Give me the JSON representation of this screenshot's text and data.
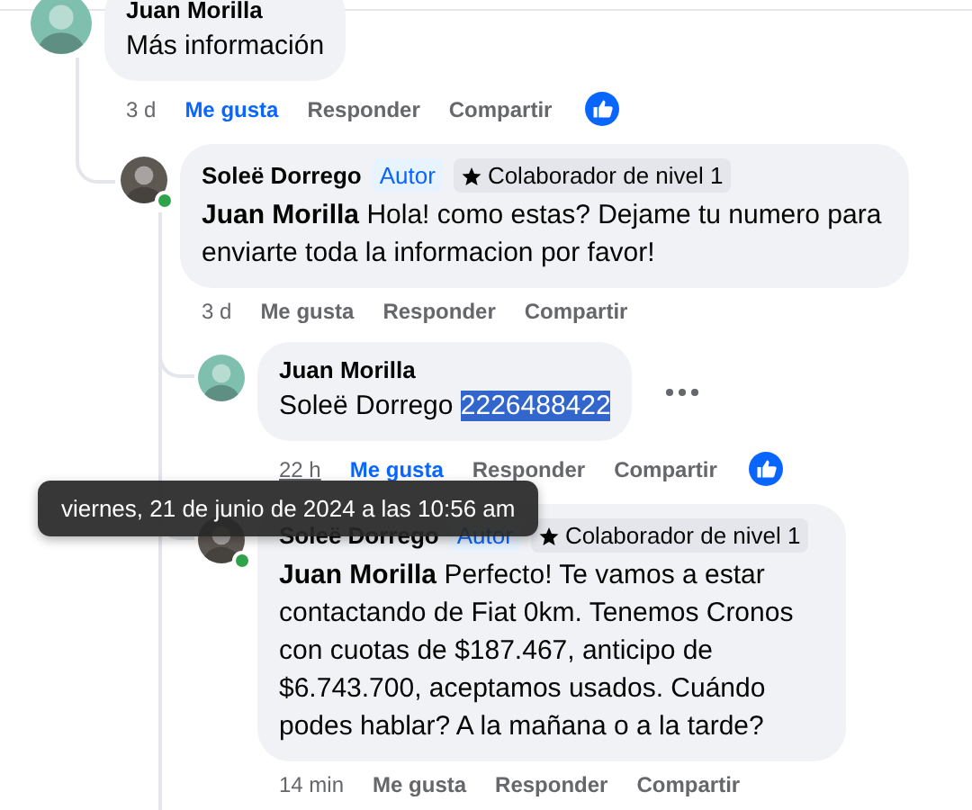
{
  "comments": [
    {
      "author": "Juan Morilla",
      "color": "#7fbfae",
      "text": "Más información",
      "highlighted": false,
      "actions": {
        "time": "3 d",
        "time_underlined": false,
        "like": "Me gusta",
        "liked": true,
        "reply": "Responder",
        "share": "Compartir"
      },
      "children": [
        {
          "author": "Soleë Dorrego",
          "color": "#5e5853",
          "online": true,
          "badges": [
            {
              "kind": "author",
              "label": "Autor"
            },
            {
              "kind": "contributor",
              "label": "Colaborador de nivel 1"
            }
          ],
          "mention": "Juan Morilla",
          "mention_bold": true,
          "text": "Hola! como estas? Dejame tu numero para enviarte toda la informacion por favor!",
          "highlighted": false,
          "actions": {
            "time": "3 d",
            "time_underlined": false,
            "like": "Me gusta",
            "liked": false,
            "reply": "Responder",
            "share": "Compartir"
          },
          "children": [
            {
              "author": "Juan Morilla",
              "color": "#7fbfae",
              "mention": "Soleë Dorrego",
              "mention_bold": false,
              "text": "2226488422",
              "highlighted": true,
              "more_options": true,
              "actions": {
                "time": "22 h",
                "time_underlined": true,
                "like": "Me gusta",
                "liked": true,
                "reply": "Responder",
                "share": "Compartir"
              }
            },
            {
              "author": "Soleë Dorrego",
              "color": "#5e5853",
              "online": true,
              "badges": [
                {
                  "kind": "author",
                  "label": "Autor"
                },
                {
                  "kind": "contributor",
                  "label": "Colaborador de nivel 1"
                }
              ],
              "mention": "Juan Morilla",
              "mention_bold": true,
              "text": "Perfecto! Te vamos a estar contactando de Fiat 0km. Tenemos Cronos con cuotas de $187.467, anticipo de $6.743.700, aceptamos usados. Cuándo podes hablar? A la mañana o a la tarde?",
              "highlighted": false,
              "actions": {
                "time": "14 min",
                "time_underlined": false,
                "like": "Me gusta",
                "liked": false,
                "reply": "Responder",
                "share": "Compartir"
              }
            }
          ]
        }
      ]
    }
  ],
  "tooltip": {
    "text": "viernes, 21 de junio de 2024 a las 10:56 am"
  }
}
